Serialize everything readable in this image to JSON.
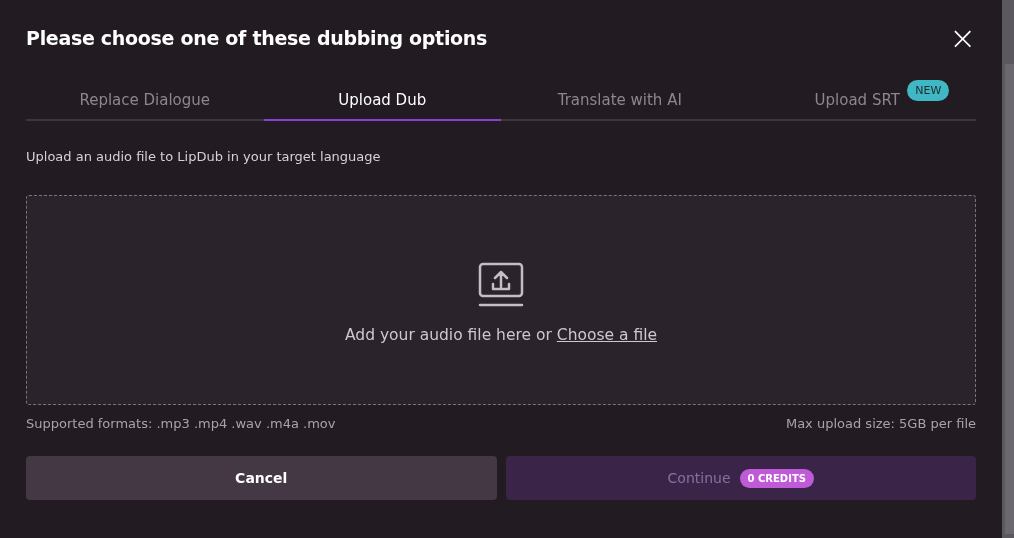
{
  "dialog": {
    "title": "Please choose one of these dubbing options",
    "close_label": "×"
  },
  "tabs": [
    {
      "label": "Replace Dialogue",
      "selected": false
    },
    {
      "label": "Upload Dub",
      "selected": true
    },
    {
      "label": "Translate with AI",
      "selected": false
    },
    {
      "label": "Upload SRT",
      "selected": false,
      "badge": "NEW"
    }
  ],
  "description": "Upload an audio file to LipDub in your target language",
  "dropzone": {
    "prompt": "Add your audio file here or",
    "link": "Choose a file"
  },
  "formats": "Supported formats: .mp3 .mp4 .wav .m4a .mov",
  "max_size": "Max upload size: 5GB per file",
  "buttons": [
    {
      "kind": "cancel",
      "label": "Cancel",
      "disabled": false
    },
    {
      "kind": "continue",
      "label": "Continue",
      "disabled": true,
      "badge": "0 CREDITS"
    }
  ]
}
